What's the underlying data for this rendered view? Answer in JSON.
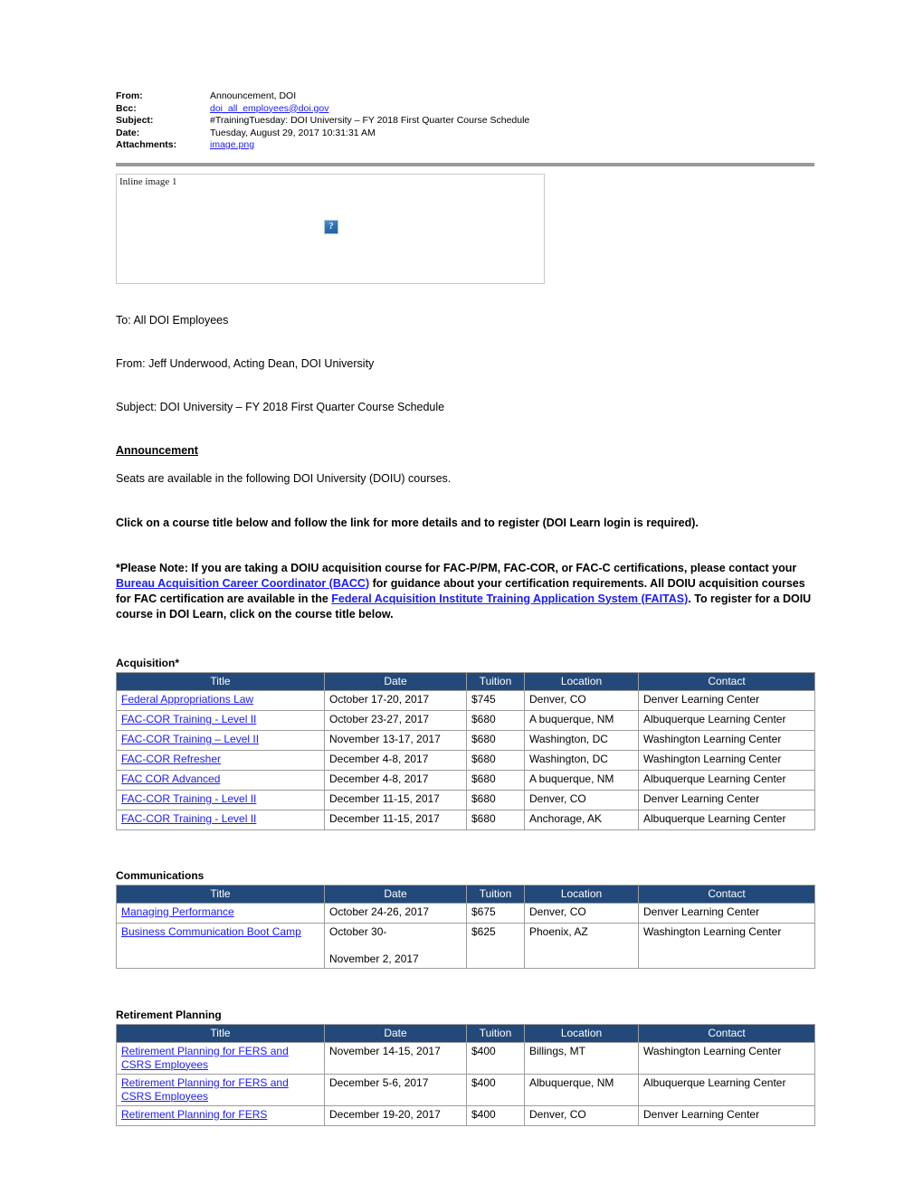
{
  "email_header": {
    "fields": [
      {
        "label": "From:",
        "value": "Announcement, DOI",
        "is_link": false
      },
      {
        "label": "Bcc:",
        "value": "doi_all_employees@doi.gov",
        "is_link": true
      },
      {
        "label": "Subject:",
        "value": "#TrainingTuesday: DOI University – FY 2018 First Quarter Course Schedule",
        "is_link": false
      },
      {
        "label": "Date:",
        "value": "Tuesday, August 29, 2017 10:31:31 AM",
        "is_link": false
      },
      {
        "label": "Attachments:",
        "value": "image.png",
        "is_link": true
      }
    ]
  },
  "inline_image": {
    "caption": "Inline image 1",
    "placeholder_glyph": "?"
  },
  "body": {
    "to_line": "To: All DOI Employees",
    "from_line": "From: Jeff Underwood, Acting Dean, DOI University",
    "subject_line": "Subject: DOI University – FY 2018 First Quarter Course Schedule",
    "announcement_heading": "Announcement",
    "seats_line": "Seats are available in the following DOI University (DOIU) courses.",
    "click_line": "Click on a course title below and follow the link for more details and to register (DOI Learn login is required).",
    "note": {
      "part1": "*Please Note: If you are taking a DOIU acquisition course for FAC-P/PM, FAC-COR, or FAC-C certifications, please contact your ",
      "link1": "Bureau Acquisition Career Coordinator (BACC)",
      "part2": " for guidance about your certification requirements. All DOIU acquisition courses for FAC certification are available in the ",
      "link2": "Federal Acquisition Institute Training Application System (FAITAS)",
      "part3": ". To register for a DOIU course in DOI Learn, click on the course title below."
    }
  },
  "columns": {
    "title": "Title",
    "date": "Date",
    "tuition": "Tuition",
    "location": "Location",
    "contact": "Contact"
  },
  "sections": [
    {
      "label": "Acquisition*",
      "rows": [
        {
          "title": "Federal Appropriations Law",
          "date": "October 17-20, 2017",
          "tuition": "$745",
          "location": "Denver, CO",
          "contact": "Denver Learning Center"
        },
        {
          "title": "FAC-COR Training - Level II",
          "date": "October 23-27, 2017",
          "tuition": "$680",
          "location": "A buquerque, NM",
          "contact": "Albuquerque Learning Center"
        },
        {
          "title": "FAC-COR Training – Level II",
          "date": "November 13-17, 2017",
          "tuition": "$680",
          "location": "Washington, DC",
          "contact": "Washington Learning Center"
        },
        {
          "title": "FAC-COR Refresher",
          "date": "December 4-8, 2017",
          "tuition": "$680",
          "location": "Washington, DC",
          "contact": "Washington Learning Center"
        },
        {
          "title": "FAC COR Advanced",
          "date": "December 4-8, 2017",
          "tuition": "$680",
          "location": "A buquerque, NM",
          "contact": "Albuquerque Learning Center"
        },
        {
          "title": "FAC-COR Training - Level II",
          "date": "December 11-15, 2017",
          "tuition": "$680",
          "location": "Denver, CO",
          "contact": "Denver Learning Center"
        },
        {
          "title": "FAC-COR Training - Level II",
          "date": "December 11-15, 2017",
          "tuition": "$680",
          "location": "Anchorage, AK",
          "contact": "Albuquerque Learning Center"
        }
      ]
    },
    {
      "label": "Communications",
      "rows": [
        {
          "title": "Managing Performance",
          "date": "October 24-26, 2017",
          "tuition": "$675",
          "location": "Denver, CO",
          "contact": "Denver Learning Center"
        },
        {
          "title": "Business Communication Boot Camp",
          "date": "October 30-\n\nNovember 2, 2017",
          "tuition": "$625",
          "location": "Phoenix, AZ",
          "contact": "Washington Learning Center"
        }
      ]
    },
    {
      "label": "Retirement Planning",
      "rows": [
        {
          "title": "Retirement Planning for FERS and CSRS Employees",
          "date": "November 14-15, 2017",
          "tuition": "$400",
          "location": "Billings, MT",
          "contact": "Washington Learning Center"
        },
        {
          "title": "Retirement Planning for FERS and CSRS Employees",
          "date": "December 5-6, 2017",
          "tuition": "$400",
          "location": "Albuquerque, NM",
          "contact": "Albuquerque Learning Center"
        },
        {
          "title": "Retirement Planning for FERS",
          "date": "December 19-20, 2017",
          "tuition": "$400",
          "location": "Denver, CO",
          "contact": "Denver Learning Center"
        }
      ]
    }
  ],
  "colors": {
    "table_header_bg": "#23497B",
    "link": "#1a1aff",
    "rule": "#9a9a9a"
  }
}
